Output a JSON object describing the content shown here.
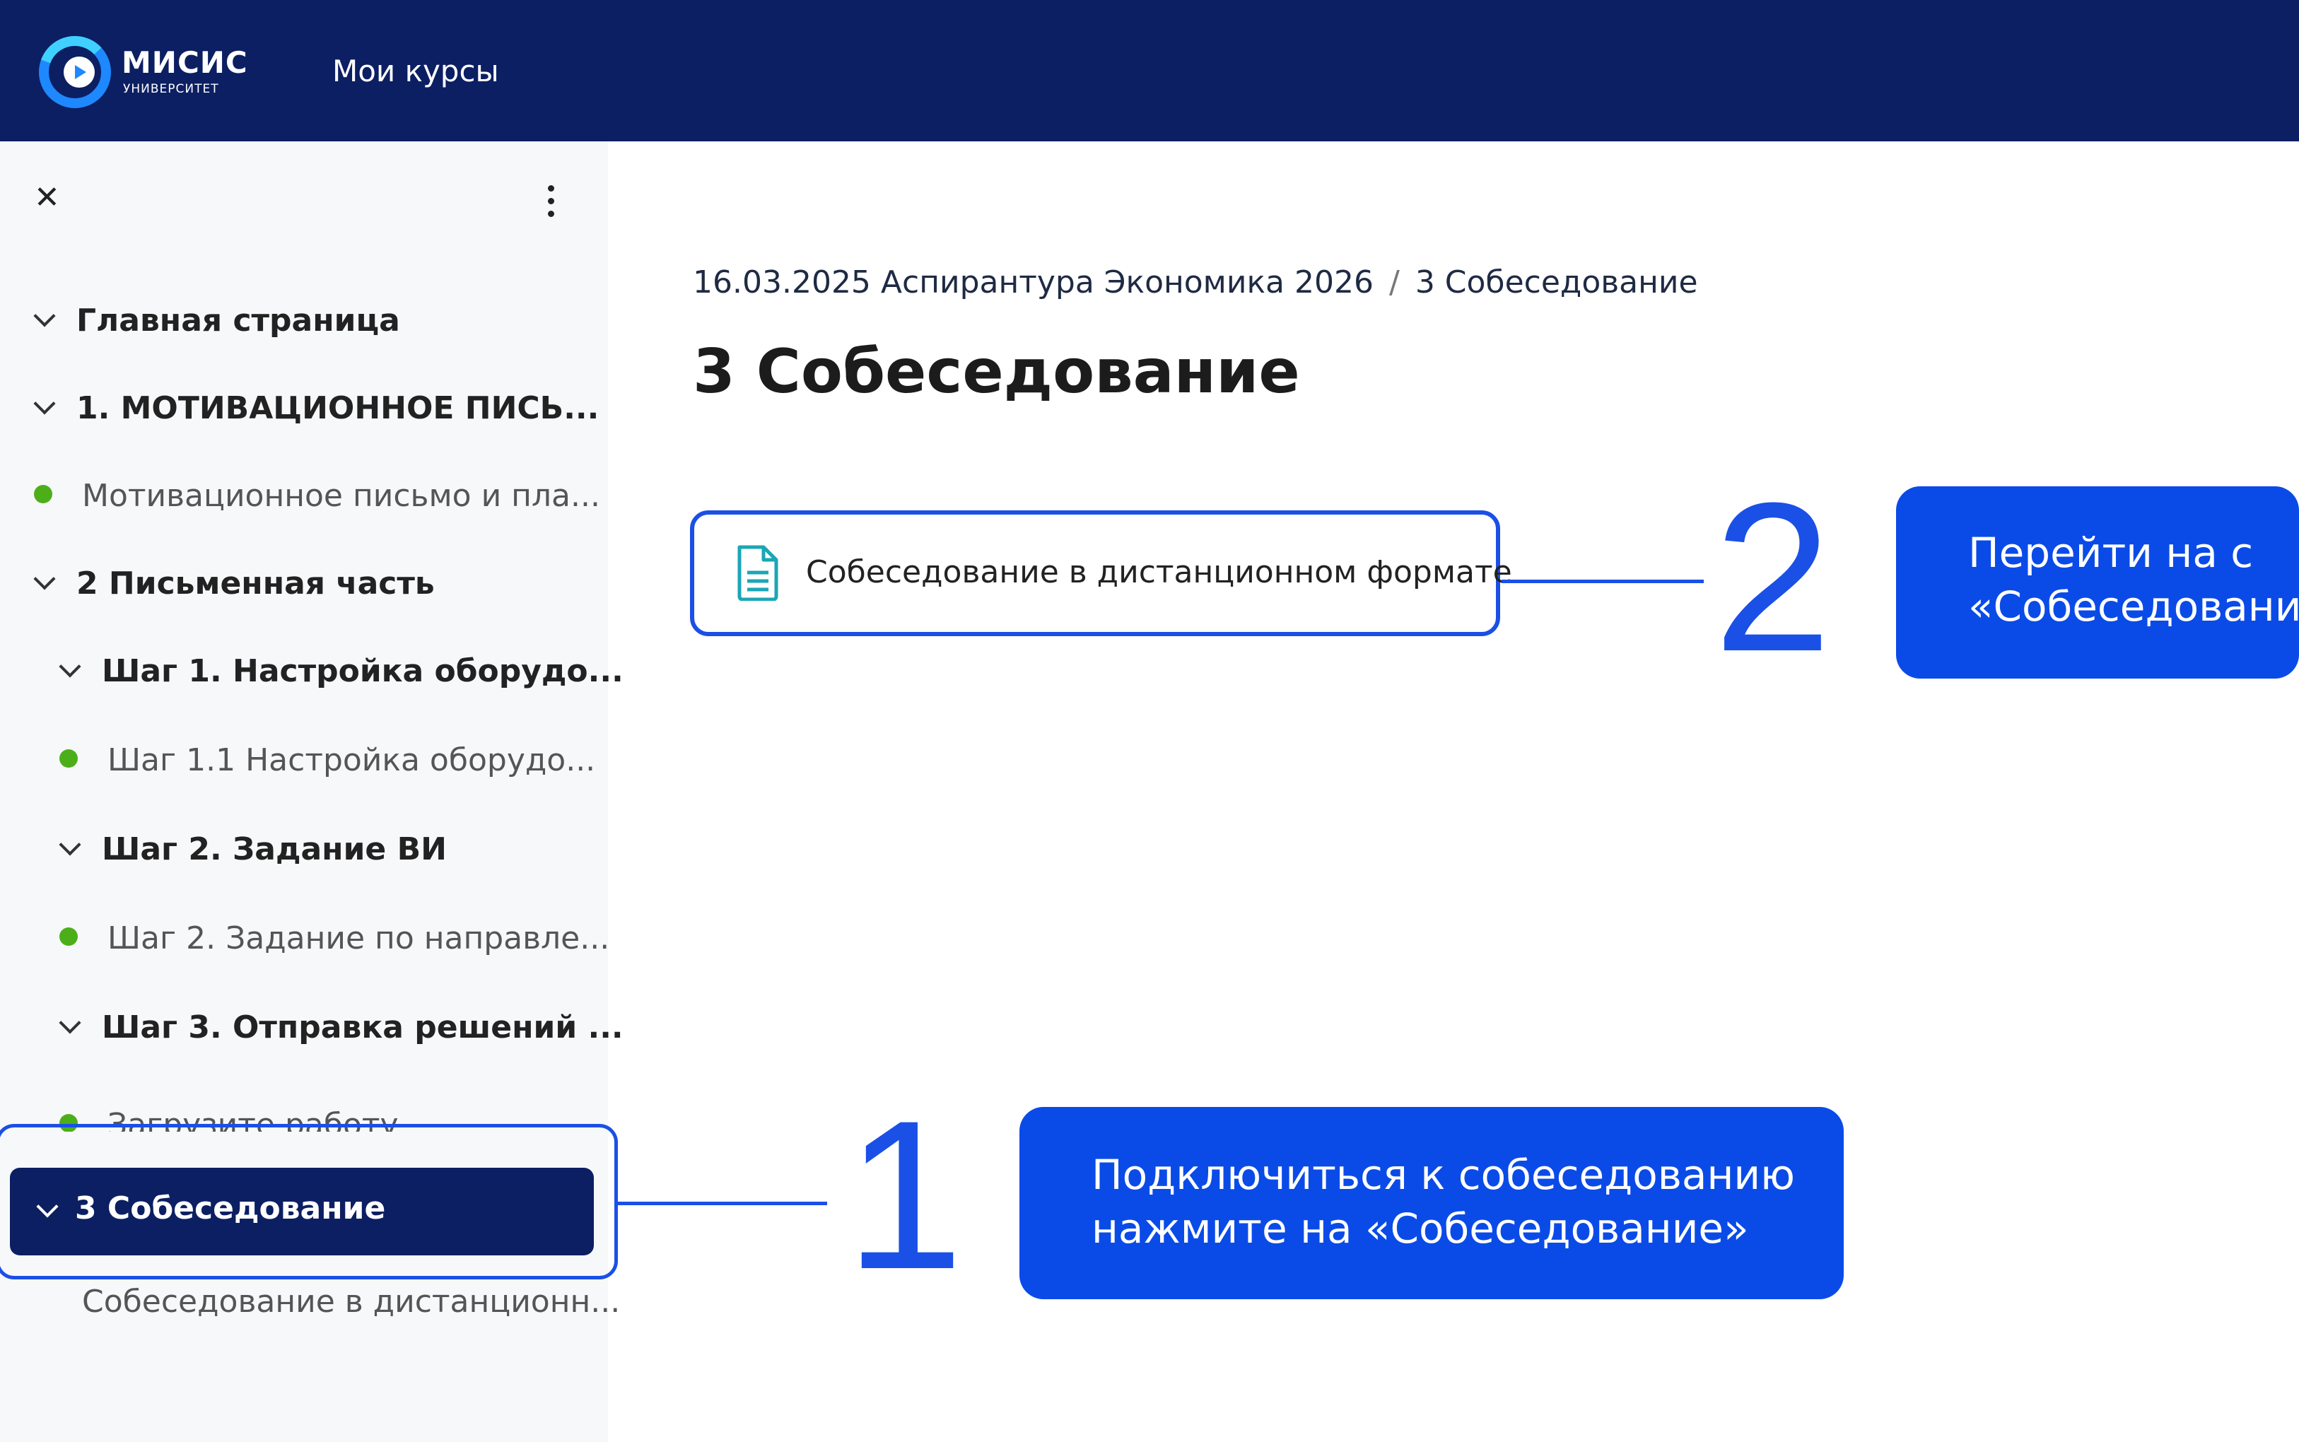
{
  "header": {
    "logo_name": "МИСИС",
    "logo_sub": "УНИВЕРСИТЕТ",
    "nav_link": "Мои курсы"
  },
  "sidebar": {
    "close_glyph": "✕",
    "items": [
      {
        "label": "Главная страница",
        "type": "section"
      },
      {
        "label": "1. МОТИВАЦИОННОЕ ПИСЬ...",
        "type": "section"
      },
      {
        "label": "Мотивационное письмо и пла...",
        "type": "activity",
        "status": "complete"
      },
      {
        "label": "2 Письменная часть",
        "type": "section"
      },
      {
        "label": "Шаг 1. Настройка оборудо...",
        "type": "subsection"
      },
      {
        "label": "Шаг 1.1 Настройка оборудо...",
        "type": "activity",
        "status": "complete"
      },
      {
        "label": "Шаг 2. Задание ВИ",
        "type": "subsection"
      },
      {
        "label": "Шаг 2. Задание по направле...",
        "type": "activity",
        "status": "complete"
      },
      {
        "label": "Шаг 3. Отправка решений ...",
        "type": "subsection"
      },
      {
        "label": "Загрузите работу",
        "type": "activity",
        "status": "complete"
      },
      {
        "label": "3 Собеседование",
        "type": "section",
        "active": true
      },
      {
        "label": "Собеседование в дистанционн...",
        "type": "activity"
      }
    ]
  },
  "main": {
    "breadcrumb": [
      "16.03.2025 Аспирантура Экономика 2026",
      "3 Собеседование"
    ],
    "breadcrumb_sep": "/",
    "title": "3 Собеседование",
    "activity_label": "Собеседование в дистанционном формате"
  },
  "annotations": {
    "num1": "1",
    "num2": "2",
    "callout1": [
      "Подключиться к собеседованию",
      "нажмите на «Собеседование»"
    ],
    "callout2": [
      "Перейти  на  с",
      "«Собеседование"
    ]
  },
  "colors": {
    "header_bg": "#0c1f63",
    "accent": "#1a50e6",
    "callout_bg": "#0a4be8",
    "status_dot": "#4caf1a"
  }
}
